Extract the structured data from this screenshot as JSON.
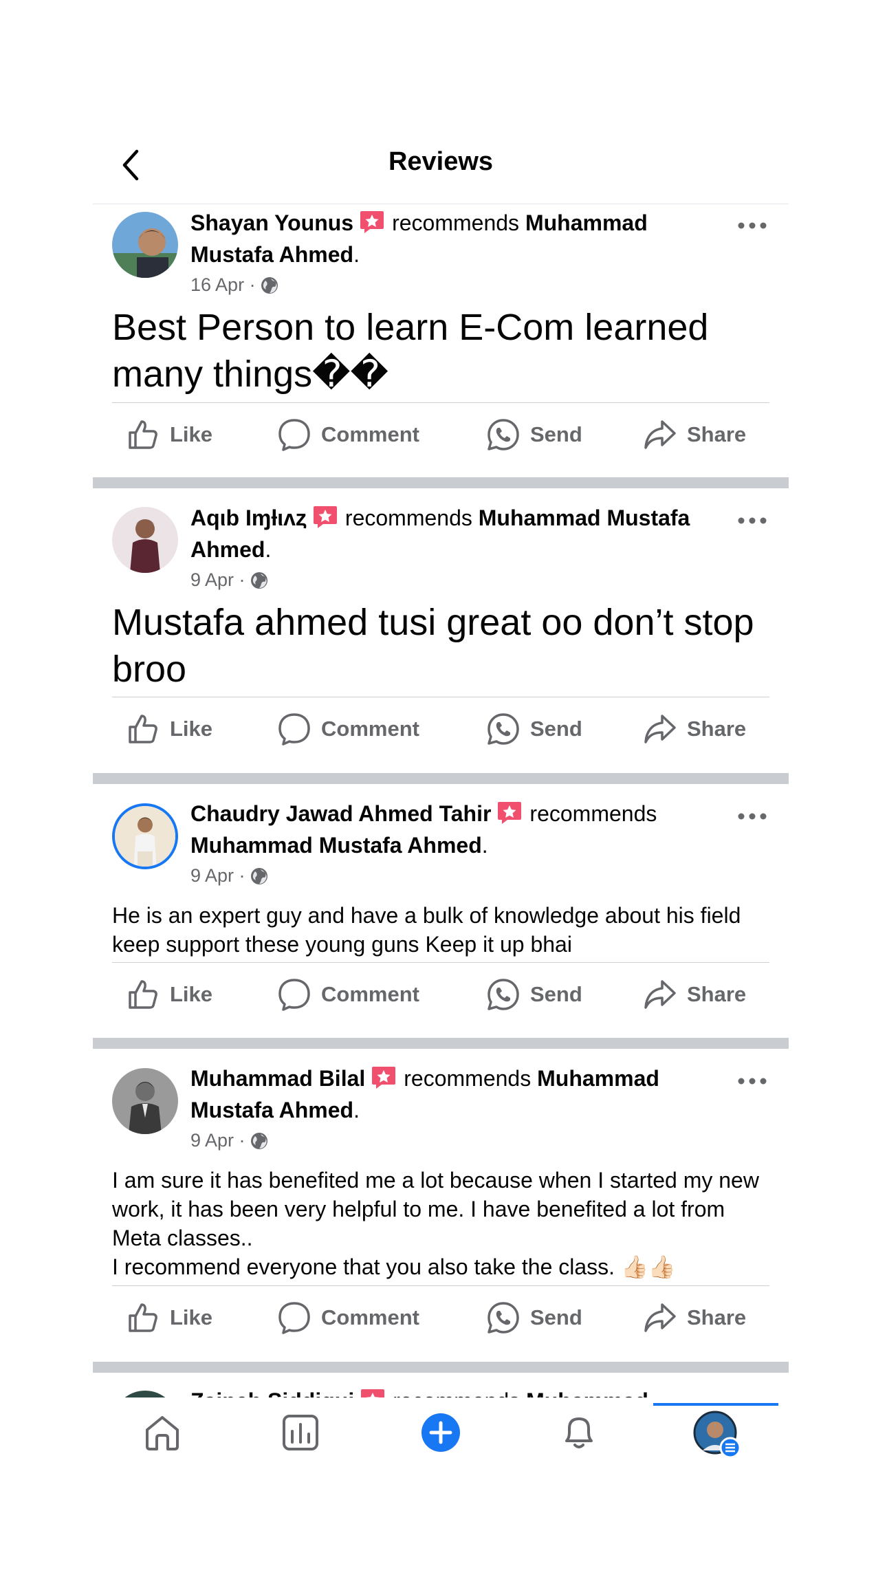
{
  "header": {
    "title": "Reviews"
  },
  "actions": {
    "like": "Like",
    "comment": "Comment",
    "send": "Send",
    "share": "Share"
  },
  "reviews": [
    {
      "author": "Shayan Younus",
      "verb": "recommends",
      "target": "Muhammad Mustafa Ahmed",
      "date": "16 Apr",
      "text": "Best Person to learn E-Com learned many things��"
    },
    {
      "author": "Aqιb Iɱƚιʌȥ",
      "verb": "recommends",
      "target": "Muhammad Mustafa Ahmed",
      "date": "9 Apr",
      "text": "Mustafa ahmed tusi great oo don’t stop broo"
    },
    {
      "author": "Chaudry Jawad Ahmed Tahir",
      "verb": "recommends",
      "target": "Muhammad Mustafa Ahmed",
      "date": "9 Apr",
      "text": "He is an expert guy and have a bulk of knowledge about his field keep support these young guns Keep it up bhai"
    },
    {
      "author": "Muhammad Bilal",
      "verb": "recommends",
      "target": "Muhammad Mustafa Ahmed",
      "date": "9 Apr",
      "text": "I am sure it has benefited me a lot because when I started my new work, it has been very helpful to me. I have benefited a lot from Meta classes..\nI recommend everyone that you also take the class. 👍🏻👍🏻"
    },
    {
      "author": "Zaineb Siddiqui",
      "verb": "recommends",
      "target": "Muhammad"
    }
  ],
  "icons": {
    "back": "chevron-left-icon",
    "more": "more-dots-icon",
    "badge": "star-badge-icon",
    "globe": "globe-icon",
    "tabs": [
      "home-icon",
      "dashboard-icon",
      "create-icon",
      "notifications-icon",
      "profile-avatar"
    ]
  },
  "colors": {
    "accent": "#1877f2",
    "badge": "#f0506e",
    "muted": "#65676b",
    "separator": "#c9ccd1"
  }
}
